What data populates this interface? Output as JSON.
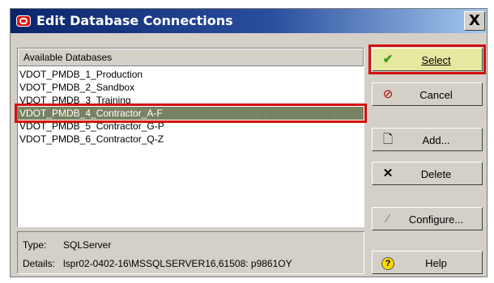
{
  "window": {
    "title": "Edit Database Connections",
    "close_label": "X"
  },
  "list": {
    "header": "Available Databases",
    "items": [
      {
        "label": "VDOT_PMDB_1_Production"
      },
      {
        "label": "VDOT_PMDB_2_Sandbox"
      },
      {
        "label": "VDOT_PMDB_3_Training"
      },
      {
        "label": "VDOT_PMDB_4_Contractor_A-F",
        "selected": true
      },
      {
        "label": "VDOT_PMDB_5_Contractor_G-P"
      },
      {
        "label": "VDOT_PMDB_6_Contractor_Q-Z"
      }
    ]
  },
  "details": {
    "type_label": "Type:",
    "type_value": "SQLServer",
    "details_label": "Details:",
    "details_value": "lspr02-0402-16\\MSSQLSERVER16,61508: p9861OY"
  },
  "buttons": {
    "select": {
      "label": "Select",
      "icon": "checkmark-icon"
    },
    "cancel": {
      "label": "Cancel",
      "icon": "cancel-icon"
    },
    "add": {
      "label": "Add...",
      "icon": "new-document-icon"
    },
    "delete": {
      "label": "Delete",
      "icon": "delete-x-icon"
    },
    "configure": {
      "label": "Configure...",
      "icon": "magic-wand-icon"
    },
    "help": {
      "label": "Help",
      "icon": "help-icon"
    }
  },
  "colors": {
    "accent_outline": "#d21010",
    "selection_bg": "#6f7b59",
    "titlebar": "#0a246a"
  }
}
